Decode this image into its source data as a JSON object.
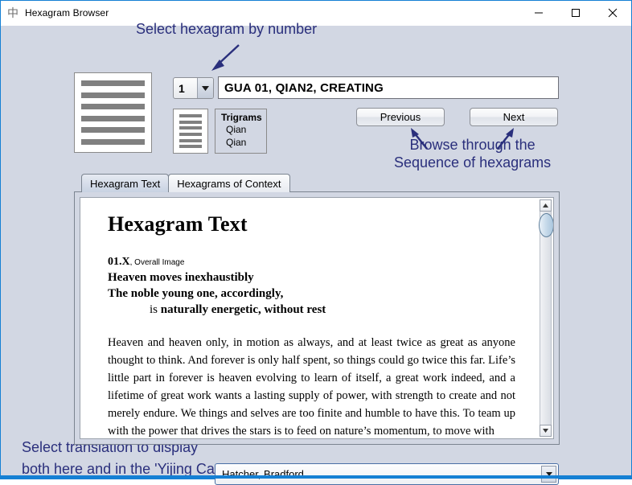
{
  "window": {
    "title": "Hexagram Browser",
    "icon": "中",
    "controls": {
      "minimize": "minimize-icon",
      "maximize": "maximize-icon",
      "close": "close-icon"
    }
  },
  "annotations": {
    "top": "Select hexagram by number",
    "right_line1": "Browse through the",
    "right_line2": "Sequence of hexagrams",
    "bottom_line1": "Select translation to display",
    "bottom_line2": "both here and in the 'Yijing Cast' pane",
    "color": "#2a2f7c"
  },
  "hexagram": {
    "lines": [
      "yang",
      "yang",
      "yang",
      "yang",
      "yang",
      "yang"
    ],
    "line_color": "#808080"
  },
  "spinner": {
    "value": "1",
    "arrow": "chevron-down-icon"
  },
  "gua_field": {
    "value": "GUA 01, QIAN2, CREATING"
  },
  "trigrams": {
    "title": "Trigrams",
    "upper": "Qian",
    "lower": "Qian",
    "upper_lines": [
      "yang",
      "yang",
      "yang"
    ],
    "lower_lines": [
      "yang",
      "yang",
      "yang"
    ]
  },
  "nav": {
    "previous": "Previous",
    "next": "Next"
  },
  "tabs": [
    {
      "label": "Hexagram Text",
      "active": true
    },
    {
      "label": "Hexagrams of Context",
      "active": false
    }
  ],
  "document": {
    "heading": "Hexagram Text",
    "ref": "01.X",
    "ref_sub": ", Overall Image",
    "line1": "Heaven moves inexhaustibly",
    "line2": "The noble young one, accordingly,",
    "line3_lead": "is ",
    "line3": "naturally energetic, without rest",
    "body": "Heaven and heaven only, in motion as always, and at least twice as great as anyone thought to think. And forever is only half spent, so things could go twice this far. Life’s little part in forever is heaven evolving to learn of itself, a great work indeed, and a lifetime of great work wants a lasting supply of power, with strength to create and not merely endure. We things and selves are too finite and humble to have this. To team up with the power that drives the stars is to feed on nature’s momentum, to move with"
  },
  "scrollbar": {
    "up_arrow": "scroll-up-icon",
    "down_arrow": "scroll-down-icon",
    "thumb_position": "top"
  },
  "translation": {
    "selected": "Hatcher, Bradford",
    "arrow": "chevron-down-icon"
  }
}
